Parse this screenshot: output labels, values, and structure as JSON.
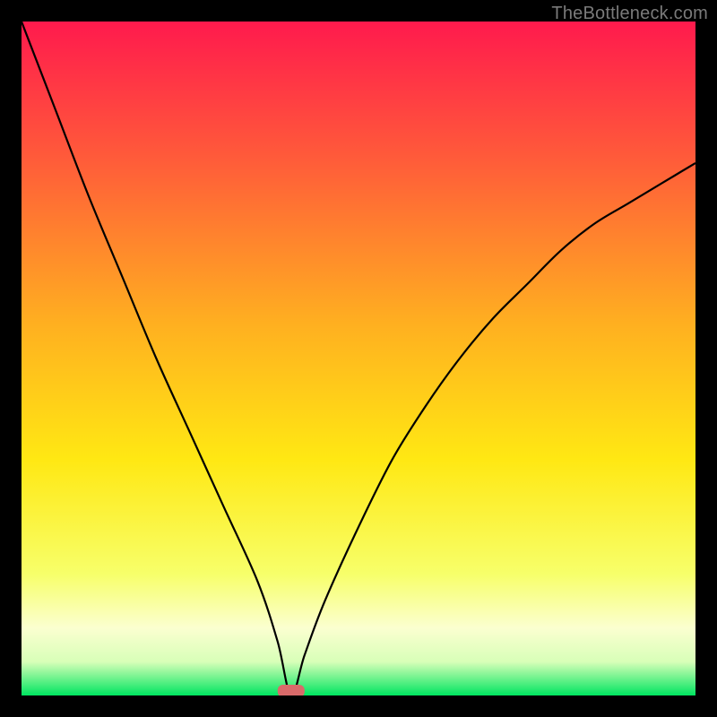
{
  "watermark": "TheBottleneck.com",
  "chart_data": {
    "type": "line",
    "title": "",
    "xlabel": "",
    "ylabel": "",
    "xlim": [
      0,
      100
    ],
    "ylim": [
      0,
      100
    ],
    "grid": false,
    "legend": false,
    "dip_x": 40,
    "dip_width": 4,
    "series": [
      {
        "name": "curve",
        "x": [
          0,
          5,
          10,
          15,
          20,
          25,
          30,
          35,
          38,
          40,
          42,
          45,
          50,
          55,
          60,
          65,
          70,
          75,
          80,
          85,
          90,
          95,
          100
        ],
        "y": [
          100,
          87,
          74,
          62,
          50,
          39,
          28,
          17,
          8,
          0,
          6,
          14,
          25,
          35,
          43,
          50,
          56,
          61,
          66,
          70,
          73,
          76,
          79
        ]
      }
    ],
    "gradient_stops": [
      {
        "offset": 0.0,
        "color": "#ff1a4d"
      },
      {
        "offset": 0.2,
        "color": "#ff5a3a"
      },
      {
        "offset": 0.45,
        "color": "#ffb020"
      },
      {
        "offset": 0.65,
        "color": "#ffe813"
      },
      {
        "offset": 0.82,
        "color": "#f7ff6a"
      },
      {
        "offset": 0.9,
        "color": "#fbffd0"
      },
      {
        "offset": 0.95,
        "color": "#d8ffb8"
      },
      {
        "offset": 1.0,
        "color": "#00e560"
      }
    ],
    "marker": {
      "x": 40,
      "y": 0,
      "color": "#d96a6a"
    }
  }
}
